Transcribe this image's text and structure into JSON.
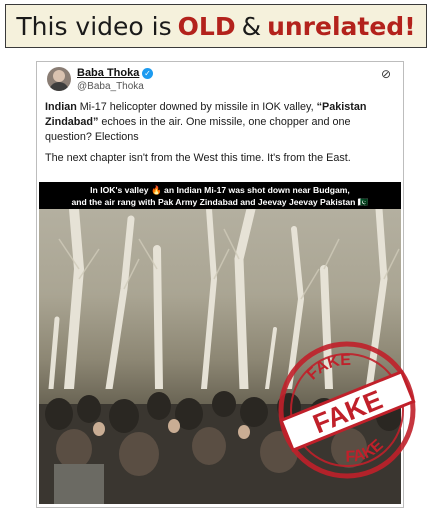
{
  "banner": {
    "prefix": "This video is",
    "word1": "OLD",
    "connector": "&",
    "word2": "unrelated",
    "suffix": "!"
  },
  "post": {
    "display_name": "Baba Thoka",
    "handle": "@Baba_Thoka",
    "text_bold1": "Indian",
    "text_1": " Mi-17 helicopter downed by missile in IOK valley, ",
    "text_bold2": "“Pakistan Zindabad”",
    "text_2": " echoes in the air. One missile, one chopper and one question? Elections",
    "text_para2": "The next chapter isn't from the West this time. It's from the East.",
    "icons": [
      "verified-badge-icon",
      "link-icon"
    ]
  },
  "video": {
    "caption_line1": "In IOK's valley 🔥 an Indian Mi-17 was shot down near Budgam,",
    "caption_line2": "and the air rang with Pak Army Zindabad and Jeevay Jeevay Pakistan 🇵🇰"
  },
  "stamp": {
    "word_top": "FAKE",
    "word_center": "FAKE",
    "word_bottom": "FAKE",
    "color": "#c0202a"
  },
  "colors": {
    "accent_red": "#b3221c",
    "banner_bg": "#f5f1dc"
  }
}
